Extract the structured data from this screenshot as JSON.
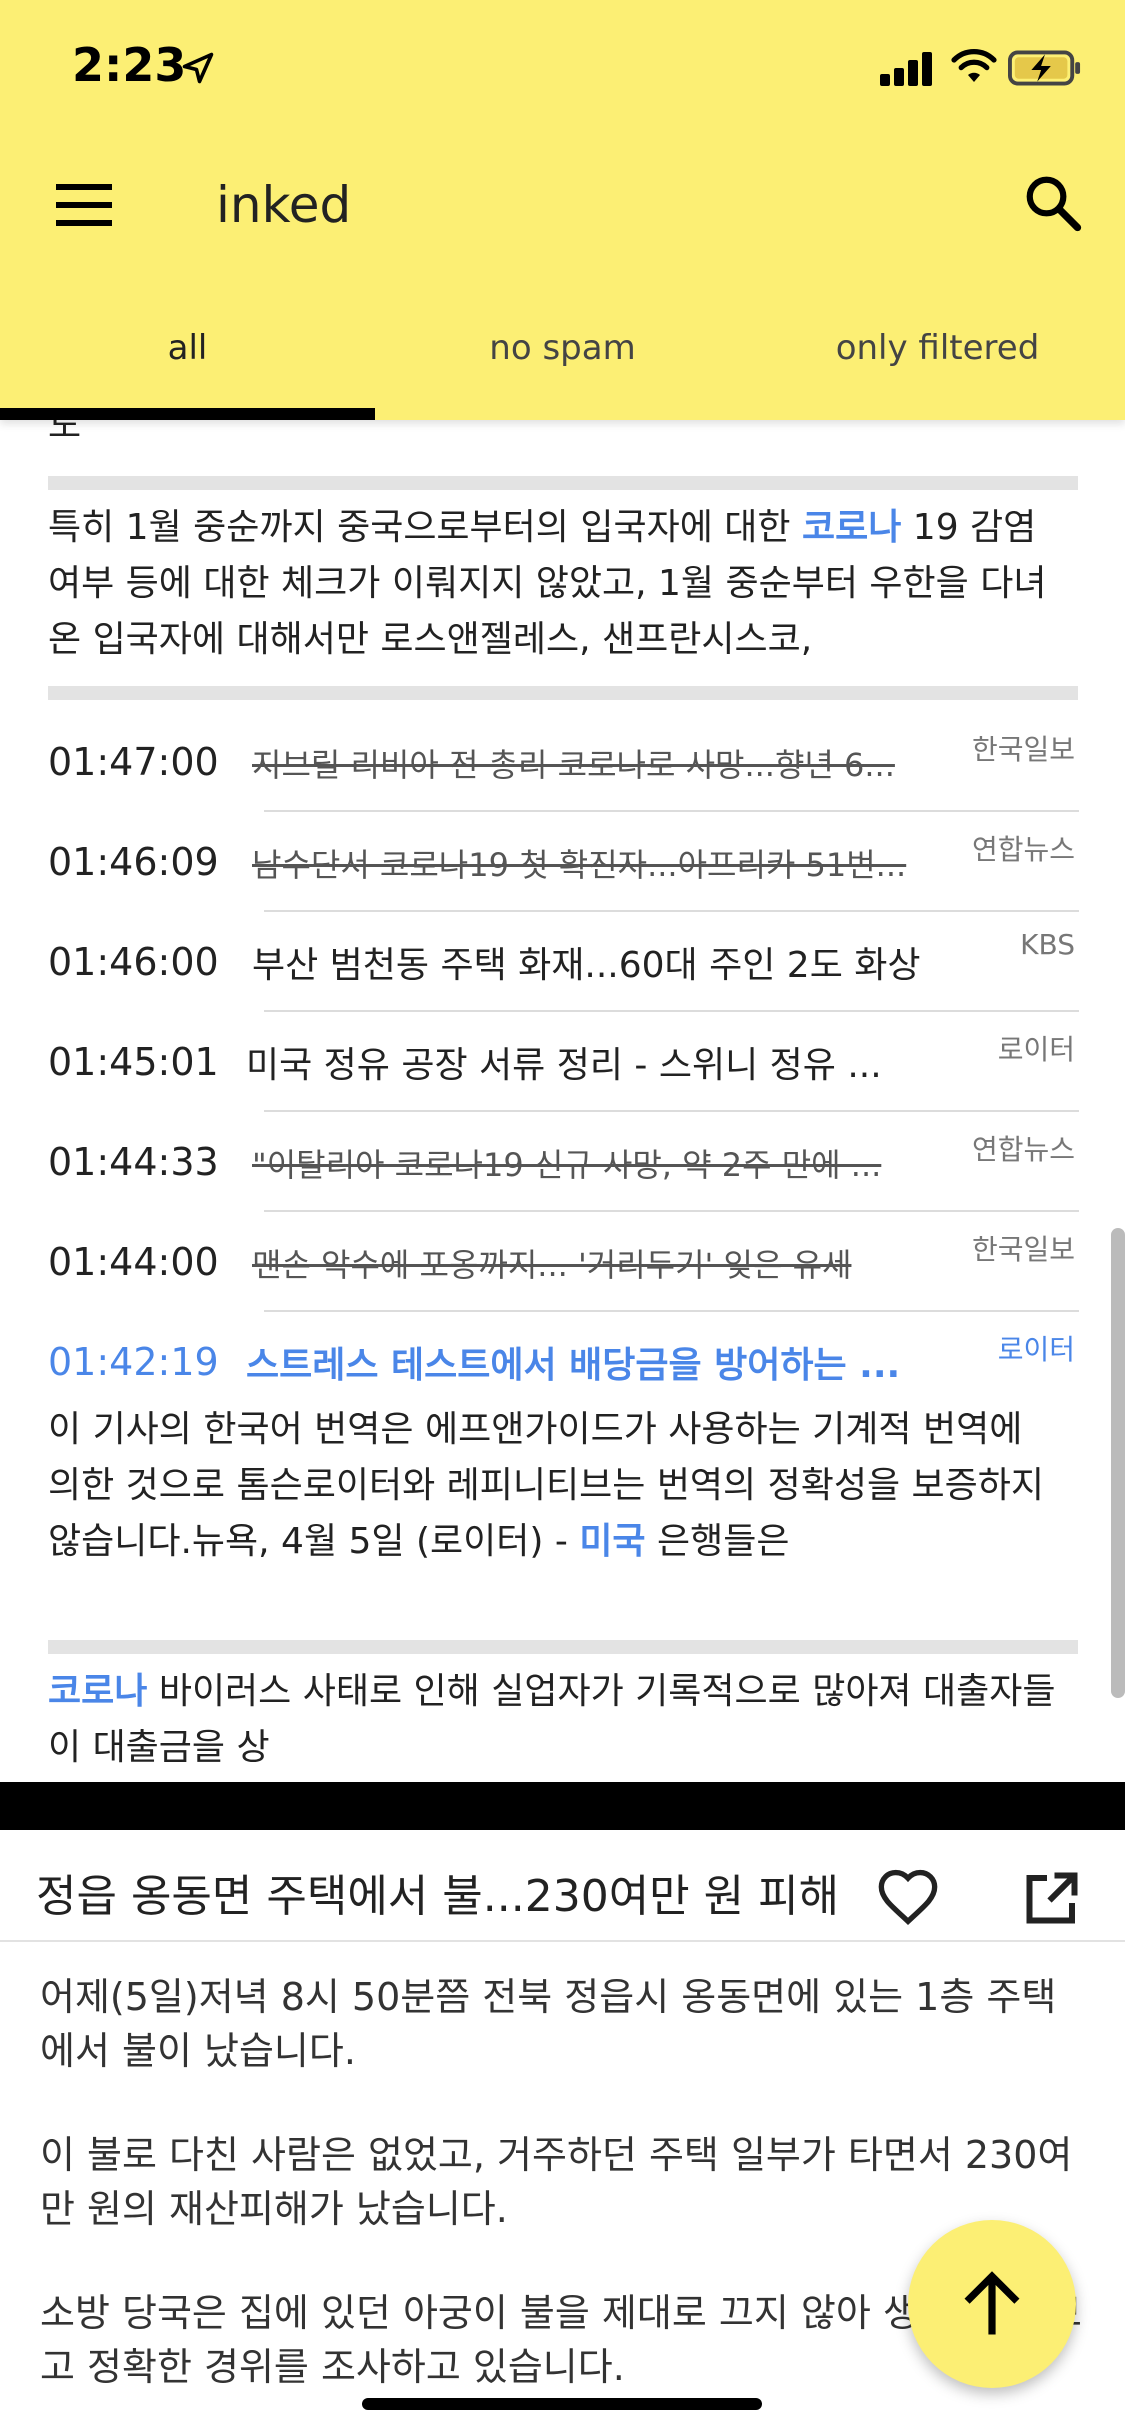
{
  "status_bar": {
    "time": "2:23"
  },
  "app": {
    "title": "inked"
  },
  "tabs": [
    {
      "label": "all"
    },
    {
      "label": "no spam"
    },
    {
      "label": "only filtered"
    }
  ],
  "list": {
    "clipped_top_text": "도",
    "excerpt1": {
      "pre": "특히 1월 중순까지 중국으로부터의 입국자에 대한 ",
      "kw": "코로나",
      "post": " 19 감염 여부 등에 대한 체크가 이뤄지지 않았고, 1월 중순부터 우한을 다녀온 입국자에 대해서만 로스앤젤레스, 샌프란시스코,"
    },
    "rows": [
      {
        "time": "01:47:00",
        "title": "지브릴 리비아 전 총리 코로나로 사망...향년 6...",
        "source": "한국일보"
      },
      {
        "time": "01:46:09",
        "title": "남수단서 코로나19 첫 확진자...아프리카 51번...",
        "source": "연합뉴스"
      },
      {
        "time": "01:46:00",
        "title": "부산 범천동 주택 화재...60대 주인 2도 화상",
        "source": "KBS"
      },
      {
        "time": "01:45:01",
        "title": "미국 정유 공장 서류 정리 - 스위니 정유 ...",
        "source": "로이터"
      },
      {
        "time": "01:44:33",
        "title": "\"이탈리아 코로나19 신규 사망, 약 2주 만에 ...",
        "source": "연합뉴스"
      },
      {
        "time": "01:44:00",
        "title": "맨손 악수에 포옹까지... '거리두기' 잊은 유세",
        "source": "한국일보"
      },
      {
        "time": "01:42:19",
        "title": "스트레스 테스트에서 배당금을 방어하는 ...",
        "source": "로이터"
      }
    ],
    "excerpt2": {
      "line1": "이 기사의 한국어 번역은 에프앤가이드가 사용하는 기계적 번역에",
      "line2": " 의한 것으로 톰슨로이터와 레피니티브는 번역의 정확성을 보증하지 않습니다.뉴욕, 4월 5일 (로이터) - ",
      "kw": "미국",
      "post": "  은행들은"
    },
    "excerpt3": {
      "kw": "코로나",
      "post": " 바이러스 사태로 인해 실업자가 기록적으로 많아져 대출자들이 대출금을 상"
    }
  },
  "article": {
    "title": "정읍 옹동면 주택에서 불...230여만 원 피해",
    "paragraphs": [
      "  어제(5일)저녁 8시 50분쯤 전북 정읍시 옹동면에 있는 1층 주택에서 불이 났습니다.",
      "이 불로 다친 사람은 없었고, 거주하던 주택 일부가 타면서 230여만 원의 재산피해가 났습니다.",
      "소방 당국은 집에 있던 아궁이 불을 제대로 끄지 않아 생긴 불로 보고 정확한 경위를 조사하고 있습니다."
    ]
  },
  "colors": {
    "header": "#fcef74",
    "accent": "#4a86e8",
    "indicator": "#000000"
  },
  "icons": [
    "location-arrow-icon",
    "cellular-signal-icon",
    "wifi-icon",
    "battery-charging-icon",
    "menu-icon",
    "search-icon",
    "heart-icon",
    "open-external-icon",
    "arrow-up-icon"
  ]
}
